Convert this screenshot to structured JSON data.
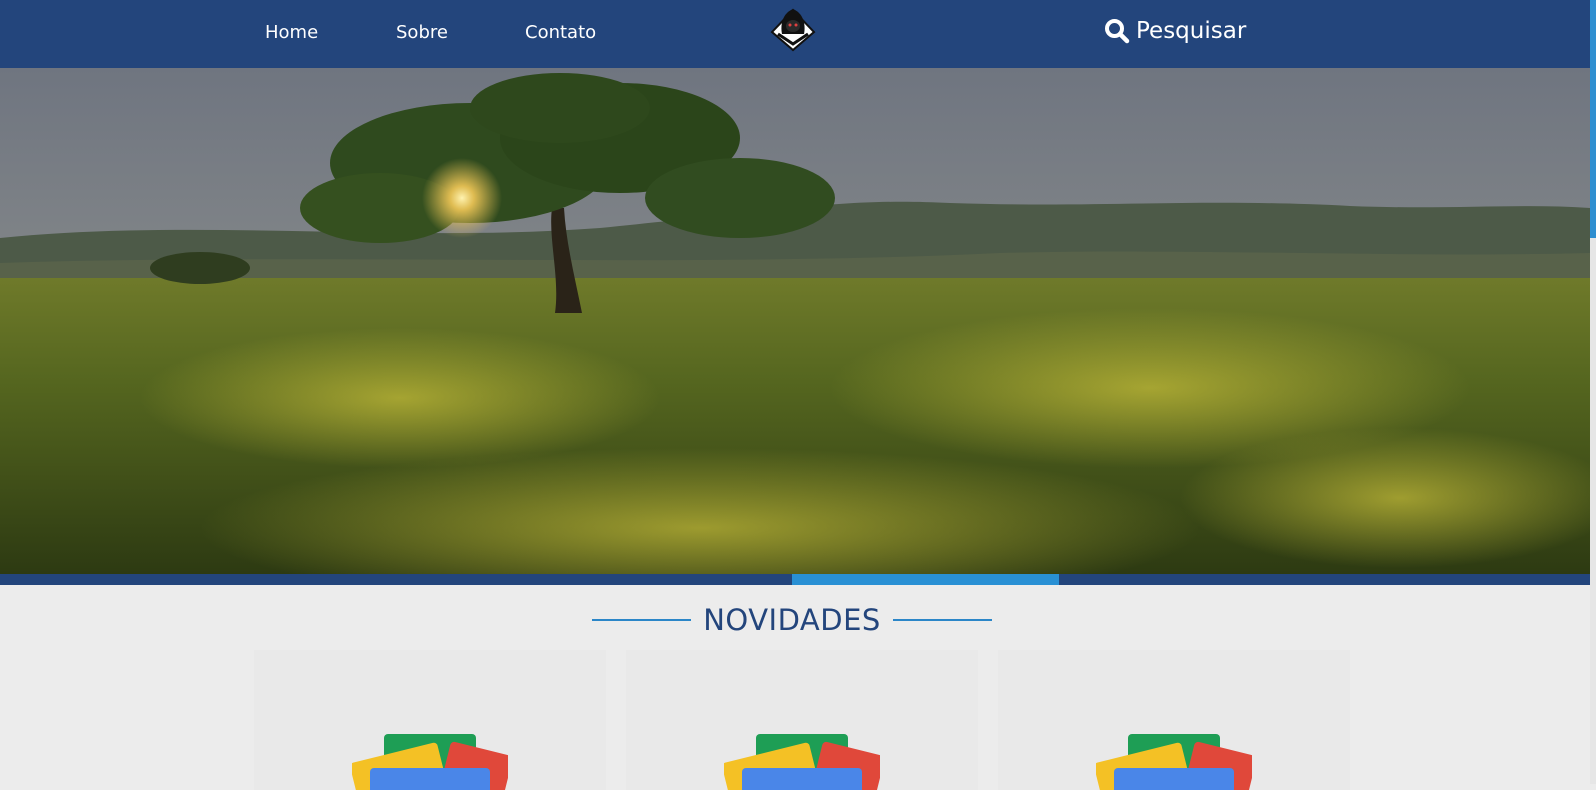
{
  "nav": {
    "links": [
      "Home",
      "Sobre",
      "Contato"
    ],
    "logo_icon": "hooded-figure-logo-icon",
    "search_label": "Pesquisar",
    "search_icon": "search-icon"
  },
  "hero": {
    "image": "sunset-tree-meadow-landscape",
    "active_slide": 4,
    "slide_count": 6
  },
  "section": {
    "title": "NOVIDADES"
  },
  "cards": [
    {
      "icon": "google-news-icon"
    },
    {
      "icon": "google-news-icon"
    },
    {
      "icon": "google-news-icon"
    }
  ],
  "colors": {
    "nav_bg": "#23457c",
    "accent": "#2990d4",
    "page_bg": "#ececec",
    "title_text": "#23457c"
  }
}
